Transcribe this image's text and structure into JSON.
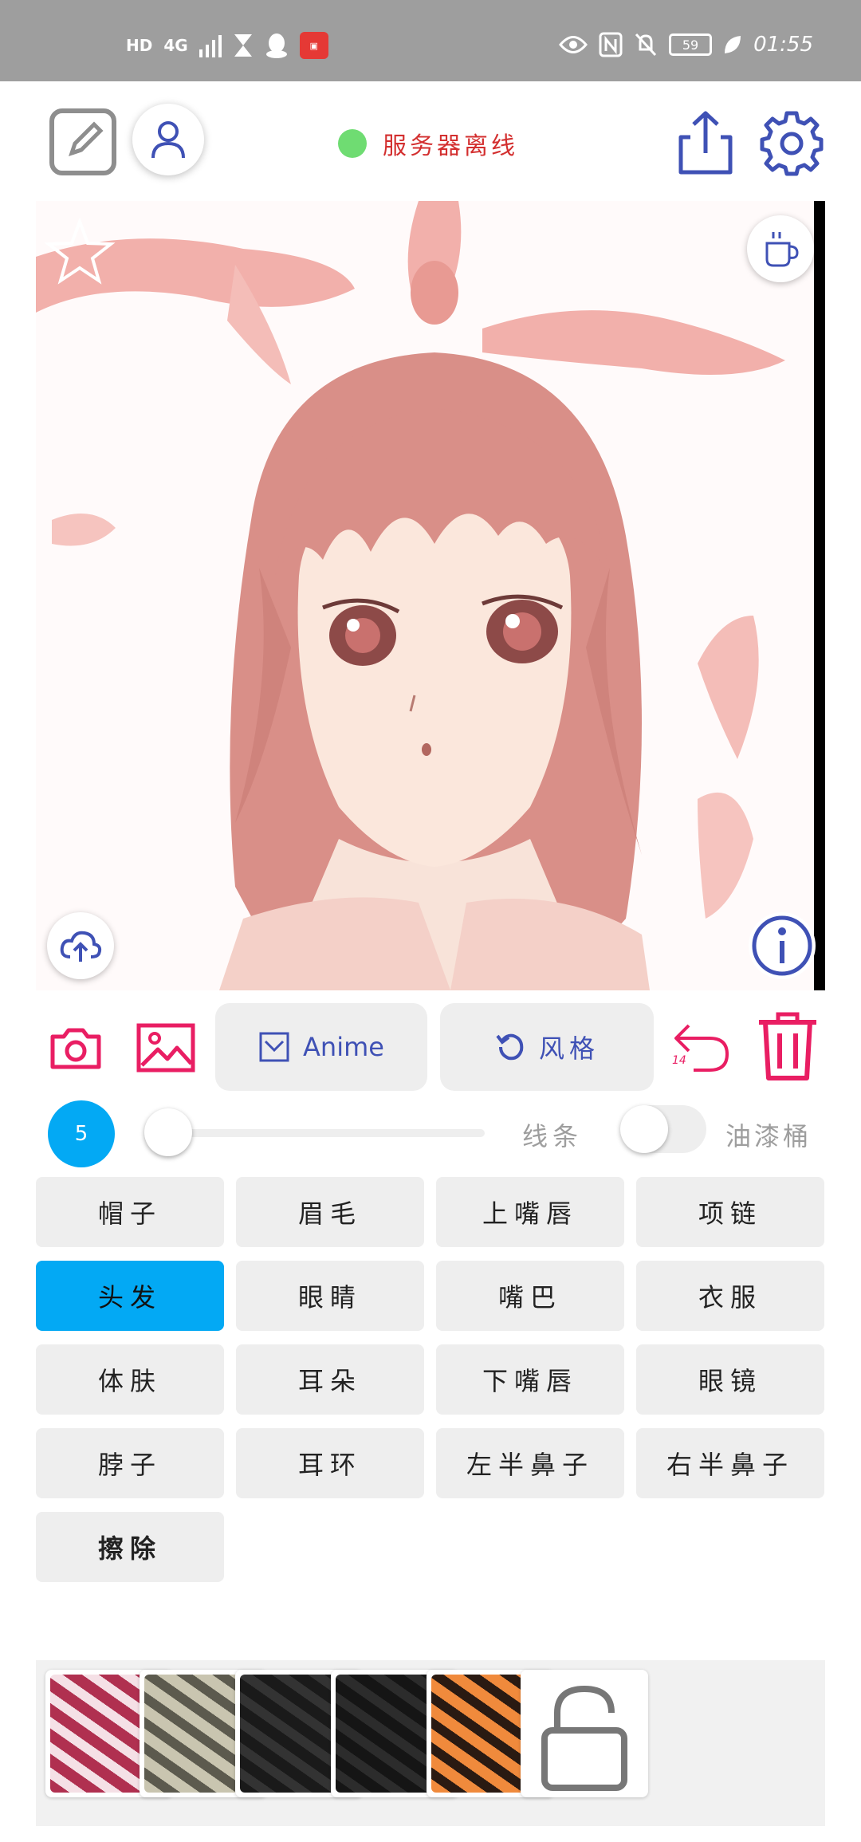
{
  "status_bar": {
    "left_icons": [
      "HD",
      "4G",
      "signal-icon",
      "hourglass-icon",
      "qq-icon",
      "app-icon"
    ],
    "hd_label": "HD",
    "network_label": "4G",
    "battery_level": "59",
    "time": "01:55"
  },
  "header": {
    "server_status_text": "服务器离线",
    "status_color": "#6fdc72"
  },
  "canvas": {
    "icons": [
      "star-icon",
      "coffee-cup-icon",
      "cloud-upload-icon",
      "info-icon"
    ]
  },
  "toolbar": {
    "anime_label": "Anime",
    "style_label": "风格",
    "undo_count": "14",
    "accent_color": "#e91e63",
    "indigo_color": "#3f51b5"
  },
  "brush": {
    "size": "5",
    "slider_value": 0.05,
    "lines_label": "线条",
    "bucket_label": "油漆桶",
    "bucket_enabled": false
  },
  "parts": {
    "active_index": 4,
    "items": [
      {
        "label": "帽子"
      },
      {
        "label": "眉毛"
      },
      {
        "label": "上嘴唇"
      },
      {
        "label": "项链"
      },
      {
        "label": "头发"
      },
      {
        "label": "眼睛"
      },
      {
        "label": "嘴巴"
      },
      {
        "label": "衣服"
      },
      {
        "label": "体肤"
      },
      {
        "label": "耳朵"
      },
      {
        "label": "下嘴唇"
      },
      {
        "label": "眼镜"
      },
      {
        "label": "脖子"
      },
      {
        "label": "耳环"
      },
      {
        "label": "左半鼻子"
      },
      {
        "label": "右半鼻子"
      },
      {
        "label": "擦除"
      }
    ]
  },
  "textures": {
    "items": [
      {
        "name": "pink-marble-texture",
        "colors": [
          "#b03050",
          "#f5e0e6"
        ]
      },
      {
        "name": "gray-marble-texture",
        "colors": [
          "#c9c5b0",
          "#5c5a4e"
        ]
      },
      {
        "name": "black-leather-texture",
        "colors": [
          "#1a1a1a",
          "#333333"
        ]
      },
      {
        "name": "black-leather-texture-2",
        "colors": [
          "#151515",
          "#2c2c2c"
        ]
      },
      {
        "name": "orange-tiger-texture",
        "colors": [
          "#f08a3c",
          "#2a1a12"
        ]
      },
      {
        "name": "lock-icon"
      }
    ]
  }
}
